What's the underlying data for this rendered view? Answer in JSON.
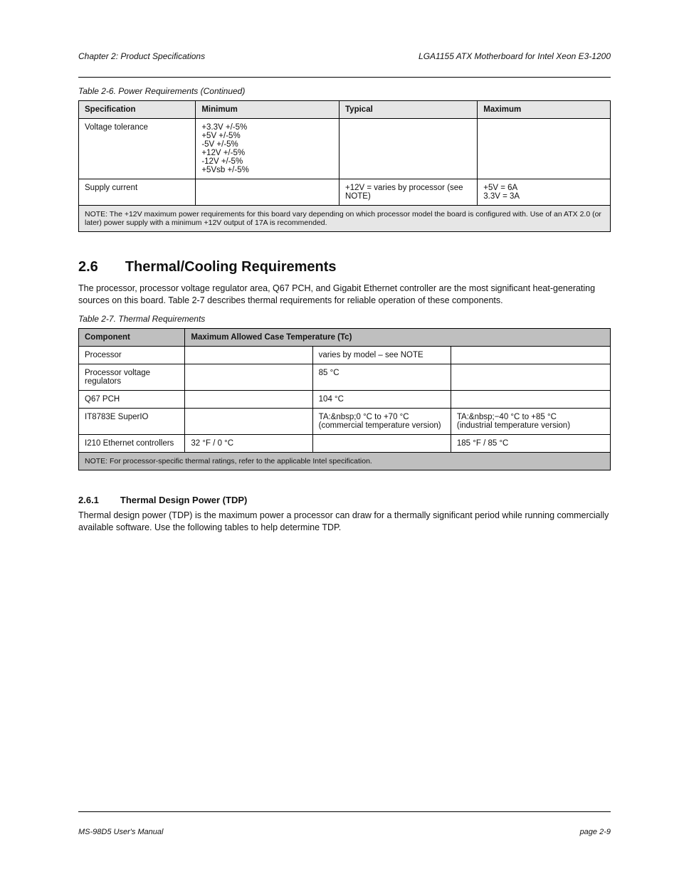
{
  "header": {
    "left": "Chapter 2: Product Specifications",
    "right": "LGA1155 ATX Motherboard for Intel Xeon E3-1200"
  },
  "table1": {
    "caption": "Table 2-6. Power Requirements (Continued)",
    "headers": [
      "Specification",
      "Minimum",
      "Typical",
      "Maximum"
    ],
    "rows": [
      [
        "Voltage tolerance",
        "+3.3V +/-5%\n+5V +/-5%\n-5V +/-5%\n+12V +/-5%\n-12V +/-5%\n+5Vsb +/-5%",
        "",
        ""
      ],
      [
        "Supply current",
        "",
        "+12V = varies by processor (see NOTE)",
        "+5V = 6A\n3.3V = 3A"
      ]
    ],
    "footnote": "NOTE: The +12V maximum power requirements for this board vary depending on which processor model the board is configured with. Use of an ATX 2.0 (or later) power supply with a minimum +12V output of 17A is recommended."
  },
  "section": {
    "number": "2.6",
    "title": "Thermal/Cooling Requirements",
    "intro": "The processor, processor voltage regulator area, Q67 PCH, and Gigabit Ethernet controller are the most significant heat-generating sources on this board. Table 2-7 describes thermal requirements for reliable operation of these components.",
    "table2": {
      "caption": "Table 2-7. Thermal Requirements",
      "header_span": "Maximum Allowed Case Temperature (Tc)",
      "col0": "Component",
      "rows": [
        [
          "Processor",
          "",
          "varies by model – see NOTE",
          ""
        ],
        [
          "Processor voltage regulators",
          "",
          "85 °C",
          ""
        ],
        [
          "Q67 PCH",
          "",
          "104 °C",
          ""
        ],
        [
          "IT8783E SuperIO",
          "",
          "TA:&nbsp;0 °C to +70 °C\n(commercial temperature version)",
          "TA:&nbsp;−40 °C to +85 °C\n(industrial temperature version)"
        ],
        [
          "I210 Ethernet controllers",
          "32 °F / 0 °C",
          "",
          "185 °F / 85 °C"
        ]
      ],
      "footnote": "NOTE: For processor-specific thermal ratings, refer to the applicable Intel specification."
    }
  },
  "subsection": {
    "number": "2.6.1",
    "title": "Thermal Design Power (TDP)",
    "body": "Thermal design power (TDP) is the maximum power a processor can draw for a thermally significant period while running commercially available software. Use the following tables to help determine TDP."
  },
  "footer": {
    "left": "MS-98D5 User's Manual",
    "right": "page 2-9"
  }
}
